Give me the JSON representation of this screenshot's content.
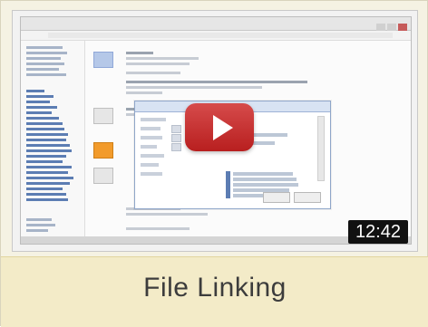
{
  "video": {
    "duration": "12:42",
    "title": "File Linking",
    "accent_color": "#c62828",
    "icon": "play-icon"
  }
}
